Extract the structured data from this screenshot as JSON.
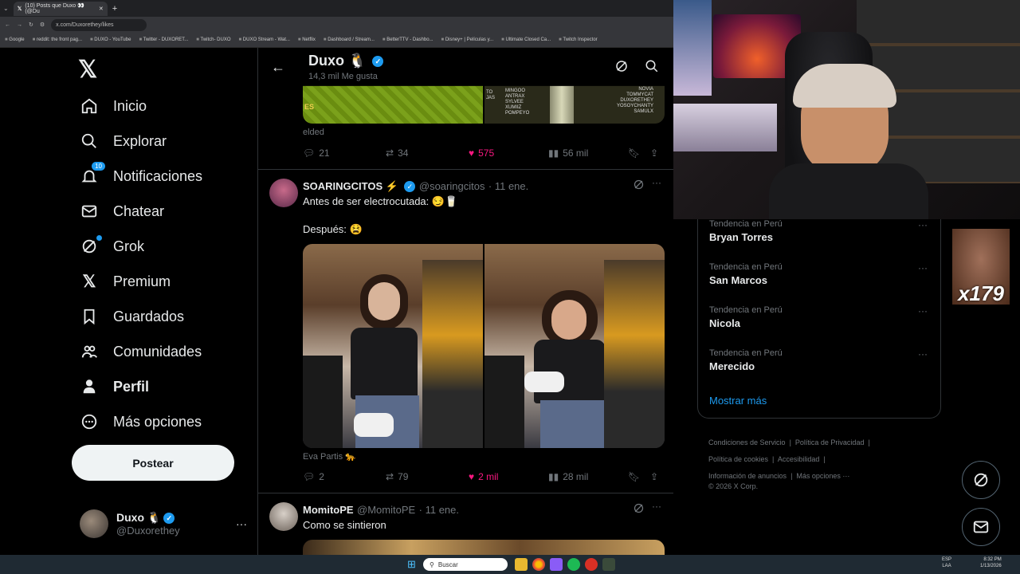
{
  "browser": {
    "tabs": [
      {
        "label": "(10) Posts que Duxo 👀 (@Du"
      }
    ],
    "url": "x.com/Duxorethey/likes",
    "bookmarks": [
      "Google",
      "reddit: the front pag...",
      "DUXO - YouTube",
      "Twitter - DUXORET...",
      "Twitch- DUXO",
      "DUXO Stream - Wat...",
      "Netflix",
      "Dashboard / Stream...",
      "BetterTTV - Dashbo...",
      "Disney+ | Películas y...",
      "Ultimate Closed Ca...",
      "Twitch Inspector"
    ]
  },
  "nav": {
    "items": [
      {
        "label": "Inicio",
        "icon": "home-icon"
      },
      {
        "label": "Explorar",
        "icon": "search-icon"
      },
      {
        "label": "Notificaciones",
        "icon": "bell-icon",
        "badge": "10"
      },
      {
        "label": "Chatear",
        "icon": "mail-icon"
      },
      {
        "label": "Grok",
        "icon": "grok-icon"
      },
      {
        "label": "Premium",
        "icon": "x-icon"
      },
      {
        "label": "Guardados",
        "icon": "bookmark-icon"
      },
      {
        "label": "Comunidades",
        "icon": "people-icon"
      },
      {
        "label": "Perfil",
        "icon": "person-icon"
      },
      {
        "label": "Más opciones",
        "icon": "more-circle-icon"
      }
    ],
    "post_button": "Postear",
    "account": {
      "name": "Duxo 🐧",
      "handle": "@Duxorethey"
    }
  },
  "header": {
    "title": "Duxo 🐧",
    "subtitle": "14,3 mil Me gusta"
  },
  "banner_text": {
    "left_names": [
      "TO",
      "JAS"
    ],
    "mid_names": [
      "MINGOO",
      "ANTRAX",
      "SYLVEE",
      "XUMIIZ",
      "POMPEYO"
    ],
    "right_names": [
      "NOVIA",
      "TOMMYCAT",
      "DUXORETHEY",
      "YOSOYCHANTY",
      "SAMULX"
    ],
    "left_label": "ES"
  },
  "tweets": [
    {
      "caption": "elded",
      "replies": "21",
      "retweets": "34",
      "likes": "575",
      "views": "56 mil"
    },
    {
      "name": "SOARINGCITOS ⚡",
      "handle": "@soaringcitos",
      "time": "· 11 ene.",
      "text1": "Antes de ser electrocutada: 😏🥛",
      "text2": "Después: 😫",
      "caption": "Eva Partis 🐆",
      "replies": "2",
      "retweets": "79",
      "likes": "2 mil",
      "views": "28 mil"
    },
    {
      "name": "MomitoPE",
      "handle": "@MomitoPE",
      "time": "· 11 ene.",
      "text1": "Como se sintieron"
    }
  ],
  "trends": [
    {
      "category": "Tendencia en Perú",
      "name": "Bryan Torres"
    },
    {
      "category": "Tendencia en Perú",
      "name": "San Marcos"
    },
    {
      "category": "Tendencia en Perú",
      "name": "Nicola"
    },
    {
      "category": "Tendencia en Perú",
      "name": "Merecido"
    }
  ],
  "show_more": "Mostrar más",
  "footer": {
    "links": [
      "Condiciones de Servicio",
      "Política de Privacidad",
      "Política de cookies",
      "Accesibilidad",
      "Información de anuncios",
      "Más opciones ···"
    ],
    "copyright": "© 2026 X Corp."
  },
  "overlay": {
    "counter": "x179"
  },
  "taskbar": {
    "search_placeholder": "Buscar",
    "lang": "ESP",
    "lang2": "LAA",
    "time": "8:32 PM",
    "date": "1/13/2026"
  },
  "colors": {
    "accent": "#1d9bf0",
    "like": "#f91880",
    "bg": "#000000"
  }
}
